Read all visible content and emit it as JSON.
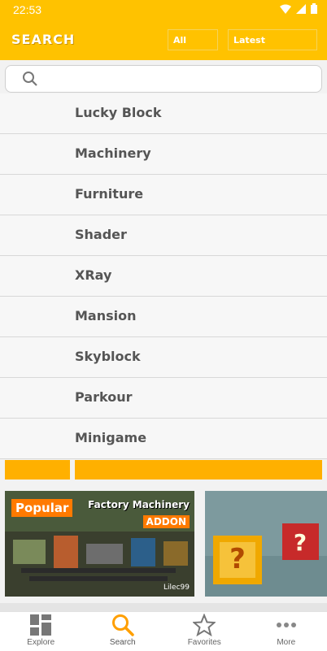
{
  "status": {
    "time": "22:53"
  },
  "header": {
    "title": "SEARCH",
    "filter_all": "All",
    "filter_sort": "Latest"
  },
  "search": {
    "placeholder": ""
  },
  "categories": [
    "Lucky Block",
    "Machinery",
    "Furniture",
    "Shader",
    "XRay",
    "Mansion",
    "Skyblock",
    "Parkour",
    "Minigame"
  ],
  "cards": [
    {
      "badge": "Popular",
      "title": "Factory Machinery",
      "tag": "ADDON",
      "author": "Lilec99"
    }
  ],
  "nav": [
    {
      "label": "Explore",
      "icon": "explore-icon"
    },
    {
      "label": "Search",
      "icon": "search-icon"
    },
    {
      "label": "Favorites",
      "icon": "star-icon"
    },
    {
      "label": "More",
      "icon": "more-icon"
    }
  ],
  "colors": {
    "accent": "#ffc200",
    "orange": "#ff7a00",
    "bar": "#ffb000"
  }
}
